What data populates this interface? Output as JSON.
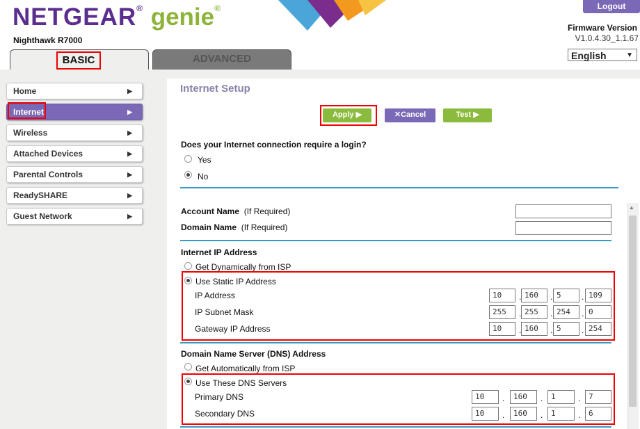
{
  "header": {
    "brand": "NETGEAR",
    "brand_sub": "genie",
    "model": "Nighthawk R7000",
    "logout": "Logout",
    "firmware_label": "Firmware Version",
    "firmware_value": "V1.0.4.30_1.1.67",
    "language": "English"
  },
  "tabs": {
    "basic": "BASIC",
    "advanced": "ADVANCED"
  },
  "sidebar": {
    "items": [
      {
        "label": "Home"
      },
      {
        "label": "Internet"
      },
      {
        "label": "Wireless"
      },
      {
        "label": "Attached Devices"
      },
      {
        "label": "Parental Controls"
      },
      {
        "label": "ReadySHARE"
      },
      {
        "label": "Guest Network"
      }
    ]
  },
  "main": {
    "title": "Internet Setup",
    "apply": "Apply",
    "cancel": "Cancel",
    "test": "Test",
    "login_question": "Does your Internet connection require a login?",
    "yes": "Yes",
    "no": "No",
    "account_name": "Account Name",
    "domain_name": "Domain Name",
    "if_required": "(If Required)",
    "ip_section": "Internet IP Address",
    "get_dynamic": "Get Dynamically from ISP",
    "use_static": "Use Static IP Address",
    "ip_address_label": "IP Address",
    "subnet_label": "IP Subnet Mask",
    "gateway_label": "Gateway IP Address",
    "ip_address": [
      "10",
      "160",
      "5",
      "109"
    ],
    "subnet": [
      "255",
      "255",
      "254",
      "0"
    ],
    "gateway": [
      "10",
      "160",
      "5",
      "254"
    ],
    "dns_section": "Domain Name Server (DNS) Address",
    "get_auto": "Get Automatically from ISP",
    "use_dns": "Use These DNS Servers",
    "primary_label": "Primary DNS",
    "secondary_label": "Secondary DNS",
    "primary_dns": [
      "10",
      "160",
      "1",
      "7"
    ],
    "secondary_dns": [
      "10",
      "160",
      "1",
      "6"
    ]
  }
}
